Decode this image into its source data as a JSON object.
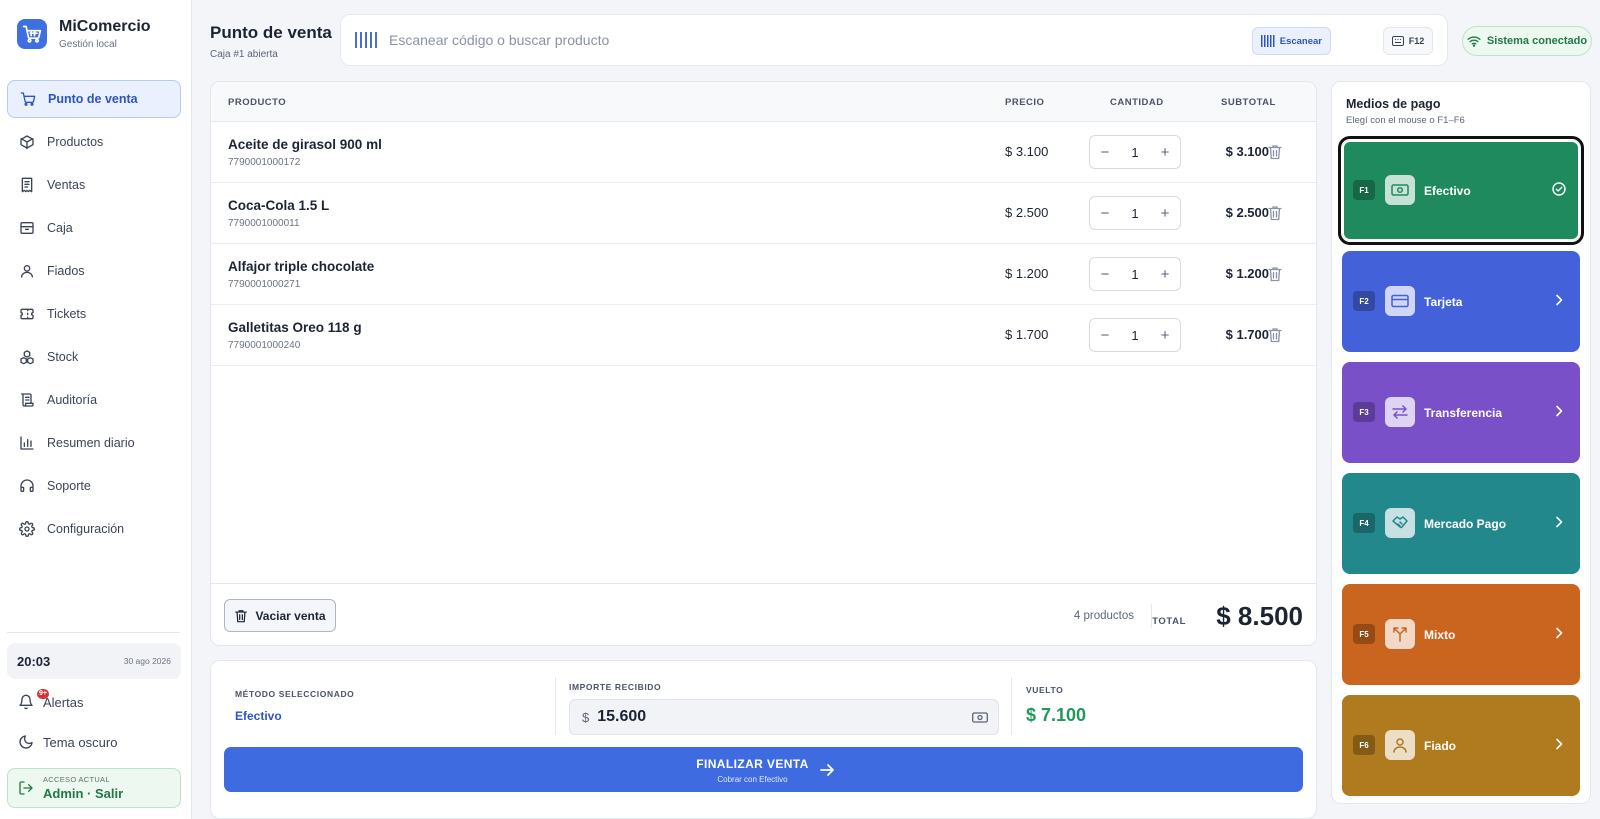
{
  "brand": {
    "name": "MiComercio",
    "subtitle": "Gestión local"
  },
  "sidebar": {
    "items": [
      {
        "label": "Punto de venta",
        "icon": "cart-icon",
        "active": true
      },
      {
        "label": "Productos",
        "icon": "box-icon"
      },
      {
        "label": "Ventas",
        "icon": "receipt-icon"
      },
      {
        "label": "Caja",
        "icon": "cash-drawer-icon"
      },
      {
        "label": "Fiados",
        "icon": "user-icon"
      },
      {
        "label": "Tickets",
        "icon": "ticket-icon"
      },
      {
        "label": "Stock",
        "icon": "boxes-icon"
      },
      {
        "label": "Auditoría",
        "icon": "scroll-icon"
      },
      {
        "label": "Resumen diario",
        "icon": "bar-chart-icon"
      },
      {
        "label": "Soporte",
        "icon": "headset-icon"
      },
      {
        "label": "Configuración",
        "icon": "gear-icon"
      }
    ],
    "clock": {
      "time": "20:03",
      "date": "30 ago 2026"
    },
    "alerts": {
      "label": "Alertas",
      "badge": "9+"
    },
    "theme": {
      "label": "Tema oscuro"
    },
    "access": {
      "label": "ACCESO ACTUAL",
      "user": "Admin · Salir"
    }
  },
  "header": {
    "title": "Punto de venta",
    "subtitle": "Caja #1 abierta",
    "search_placeholder": "Escanear código o buscar producto",
    "scan_label": "Escanear",
    "shortcut_label": "F12",
    "status": "Sistema conectado"
  },
  "cart": {
    "columns": {
      "product": "PRODUCTO",
      "price": "PRECIO",
      "quantity": "CANTIDAD",
      "subtotal": "SUBTOTAL"
    },
    "items": [
      {
        "name": "Aceite de girasol 900 ml",
        "code": "7790001000172",
        "price": "$ 3.100",
        "qty": "1",
        "subtotal": "$ 3.100"
      },
      {
        "name": "Coca-Cola 1.5 L",
        "code": "7790001000011",
        "price": "$ 2.500",
        "qty": "1",
        "subtotal": "$ 2.500"
      },
      {
        "name": "Alfajor triple chocolate",
        "code": "7790001000271",
        "price": "$ 1.200",
        "qty": "1",
        "subtotal": "$ 1.200"
      },
      {
        "name": "Galletitas Oreo 118 g",
        "code": "7790001000240",
        "price": "$ 1.700",
        "qty": "1",
        "subtotal": "$ 1.700"
      }
    ],
    "clear_label": "Vaciar venta",
    "count_label": "4 productos",
    "total_label": "TOTAL",
    "total_value": "$ 8.500"
  },
  "checkout": {
    "method_label": "MÉTODO SELECCIONADO",
    "method_value": "Efectivo",
    "received_label": "IMPORTE RECIBIDO",
    "currency": "$",
    "received_value": "15.600",
    "change_label": "VUELTO",
    "change_value": "$ 7.100",
    "finalize_label": "FINALIZAR VENTA",
    "finalize_sub": "Cobrar con Efectivo"
  },
  "payment": {
    "title": "Medios de pago",
    "subtitle": "Elegí con el mouse o F1–F6",
    "methods": [
      {
        "key": "F1",
        "label": "Efectivo",
        "color": "#1e8a5e",
        "icon": "cash-icon",
        "selected": true
      },
      {
        "key": "F2",
        "label": "Tarjeta",
        "color": "#4361d8",
        "icon": "credit-card-icon"
      },
      {
        "key": "F3",
        "label": "Transferencia",
        "color": "#7a50c9",
        "icon": "transfer-icon"
      },
      {
        "key": "F4",
        "label": "Mercado Pago",
        "color": "#23888c",
        "icon": "handshake-icon"
      },
      {
        "key": "F5",
        "label": "Mixto",
        "color": "#c9651e",
        "icon": "split-icon"
      },
      {
        "key": "F6",
        "label": "Fiado",
        "color": "#b07a1e",
        "icon": "user-icon"
      }
    ]
  }
}
